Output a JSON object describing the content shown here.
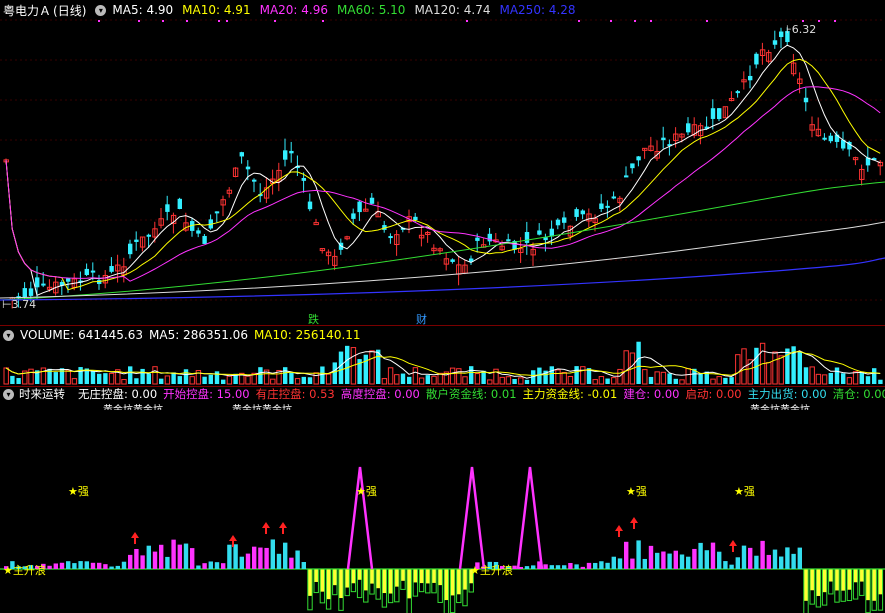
{
  "price_panel": {
    "stock_name": "粤电力Ａ",
    "period": "(日线)",
    "ma_items": [
      {
        "label": "MA5: 4.90",
        "color": "#ffffff"
      },
      {
        "label": "MA10: 4.91",
        "color": "#ffff00"
      },
      {
        "label": "MA20: 4.96",
        "color": "#ff33ff"
      },
      {
        "label": "MA60: 5.10",
        "color": "#33dd33"
      },
      {
        "label": "MA120: 4.74",
        "color": "#dddddd"
      },
      {
        "label": "MA250: 4.28",
        "color": "#3333ff"
      }
    ],
    "high_label": "6.32",
    "low_label": "3.74",
    "event_tags": [
      {
        "text": "跌",
        "color": "#33dd33"
      },
      {
        "text": "财",
        "color": "#3399ff"
      }
    ]
  },
  "volume_panel": {
    "items": [
      {
        "label": "VOLUME: 641445.63",
        "color": "#ffffff"
      },
      {
        "label": "MA5: 286351.06",
        "color": "#ffffff"
      },
      {
        "label": "MA10: 256140.11",
        "color": "#ffff00"
      }
    ]
  },
  "indicator_panel": {
    "name": "时来运转",
    "items": [
      {
        "label": "无庄控盘: 0.00",
        "color": "#ffffff"
      },
      {
        "label": "开始控盘: 15.00",
        "color": "#ff33ff"
      },
      {
        "label": "有庄控盘: 0.53",
        "color": "#ff3333"
      },
      {
        "label": "高度控盘: 0.00",
        "color": "#ff33ff"
      },
      {
        "label": "散户资金线: 0.01",
        "color": "#33dd33"
      },
      {
        "label": "主力资金线: -0.01",
        "color": "#ffff00"
      },
      {
        "label": "建仓: 0.00",
        "color": "#ff33ff"
      },
      {
        "label": "启动: 0.00",
        "color": "#ff3333"
      },
      {
        "label": "主力出货: 0.00",
        "color": "#33ddee"
      },
      {
        "label": "清仓: 0.00",
        "color": "#33dd33"
      }
    ],
    "sub_labels": [
      "黄金坑黄金坑",
      "黄金坑黄金坑",
      "黄金坑黄金坑"
    ],
    "strong_label": "★强",
    "wave_label": "★主升浪"
  }
}
